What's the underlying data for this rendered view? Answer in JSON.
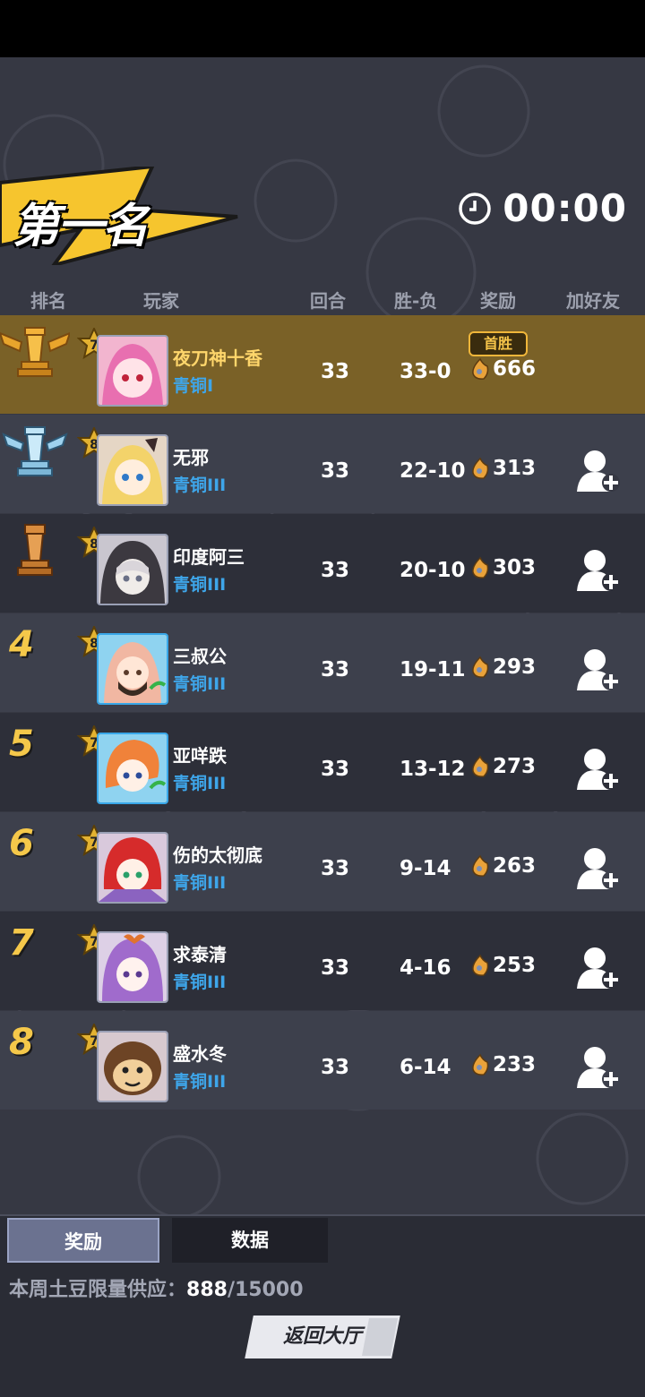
{
  "header": {
    "title": "第一名",
    "timer": "00:00"
  },
  "columns": {
    "rank": "排名",
    "player": "玩家",
    "rounds": "回合",
    "record": "胜-负",
    "reward": "奖励",
    "add_friend": "加好友"
  },
  "first_win_badge": "首胜",
  "players": [
    {
      "rank": "1",
      "rank_display": "gold-trophy-icon",
      "level": "7",
      "name": "夜刀神十香",
      "tier": "青铜I",
      "rounds": "33",
      "record": "33-0",
      "reward": "666",
      "add_friend": false
    },
    {
      "rank": "2",
      "rank_display": "silver-trophy-icon",
      "level": "8",
      "name": "无邪",
      "tier": "青铜III",
      "rounds": "33",
      "record": "22-10",
      "reward": "313",
      "add_friend": true
    },
    {
      "rank": "3",
      "rank_display": "bronze-rook-icon",
      "level": "8",
      "name": "印度阿三",
      "tier": "青铜III",
      "rounds": "33",
      "record": "20-10",
      "reward": "303",
      "add_friend": true
    },
    {
      "rank": "4",
      "rank_display": "4",
      "level": "8",
      "name": "三叔公",
      "tier": "青铜III",
      "rounds": "33",
      "record": "19-11",
      "reward": "293",
      "add_friend": true
    },
    {
      "rank": "5",
      "rank_display": "5",
      "level": "7",
      "name": "亚咩跌",
      "tier": "青铜III",
      "rounds": "33",
      "record": "13-12",
      "reward": "273",
      "add_friend": true
    },
    {
      "rank": "6",
      "rank_display": "6",
      "level": "7",
      "name": "伤的太彻底",
      "tier": "青铜III",
      "rounds": "33",
      "record": "9-14",
      "reward": "263",
      "add_friend": true
    },
    {
      "rank": "7",
      "rank_display": "7",
      "level": "7",
      "name": "求泰清",
      "tier": "青铜III",
      "rounds": "33",
      "record": "4-16",
      "reward": "253",
      "add_friend": true
    },
    {
      "rank": "8",
      "rank_display": "8",
      "level": "7",
      "name": "盛水冬",
      "tier": "青铜III",
      "rounds": "33",
      "record": "6-14",
      "reward": "233",
      "add_friend": true
    }
  ],
  "tabs": {
    "rewards": "奖励",
    "data": "数据"
  },
  "supply": {
    "label": "本周土豆限量供应：",
    "current": "888",
    "total": "/15000"
  },
  "back_button": "返回大厅",
  "colors": {
    "background": "#363843",
    "first_row": "#7a6127",
    "gold": "#f5c84a",
    "tier_blue": "#3ea6ea"
  }
}
